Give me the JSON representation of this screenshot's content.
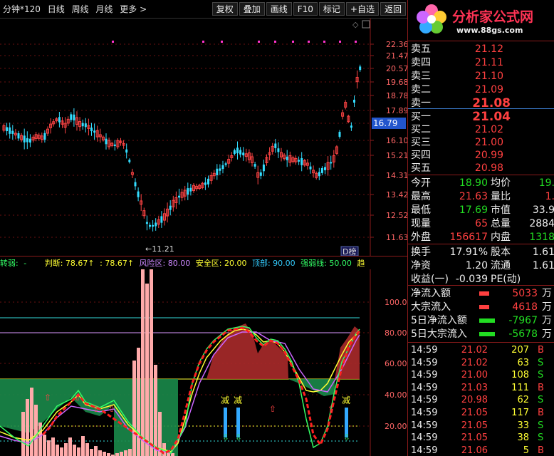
{
  "toolbar": {
    "left_items": [
      "分钟*120",
      "日线",
      "周线",
      "月线",
      "更多 >"
    ],
    "buttons": [
      "复权",
      "叠加",
      "画线",
      "F10",
      "标记",
      "+自选",
      "返回"
    ]
  },
  "price_chart": {
    "y_ticks": [
      "22.36",
      "21.47",
      "20.57",
      "19.68",
      "18.78",
      "17.89",
      "16.79",
      "16.10",
      "15.21",
      "14.31",
      "13.42",
      "12.52",
      "11.63"
    ],
    "current_price_label": "16.79",
    "low_annotation": "←11.21",
    "corner_badge": "D榜"
  },
  "indicator": {
    "header": [
      {
        "text": "转弱:",
        "color": "#33ff66"
      },
      {
        "text": "-",
        "color": "#33ff66"
      },
      {
        "text": "判断: 78.67↑",
        "color": "#ffff33"
      },
      {
        "text": ": 78.67↑",
        "color": "#ffff33"
      },
      {
        "text": "风险区: 80.00",
        "color": "#cc88ff"
      },
      {
        "text": "安全区: 20.00",
        "color": "#ffff33"
      },
      {
        "text": "顶部: 90.00",
        "color": "#33ccff"
      },
      {
        "text": "强弱线: 50.00",
        "color": "#33ff66"
      },
      {
        "text": "趋",
        "color": "#ffff33"
      }
    ],
    "y_ticks": [
      "100.0",
      "80.00",
      "60.00",
      "40.00",
      "20.00"
    ],
    "jian_label": "减"
  },
  "right_panel": {
    "logo": {
      "title": "分析家公式网",
      "url": "www.88gs.com"
    },
    "sell": [
      {
        "label": "卖五",
        "price": "21.12"
      },
      {
        "label": "卖四",
        "price": "21.11"
      },
      {
        "label": "卖三",
        "price": "21.10"
      },
      {
        "label": "卖二",
        "price": "21.09"
      },
      {
        "label": "卖一",
        "price": "21.08"
      }
    ],
    "buy": [
      {
        "label": "买一",
        "price": "21.04"
      },
      {
        "label": "买二",
        "price": "21.02"
      },
      {
        "label": "买三",
        "price": "21.00"
      },
      {
        "label": "买四",
        "price": "20.99"
      },
      {
        "label": "买五",
        "price": "20.98"
      }
    ],
    "stats": [
      {
        "l1": "今开",
        "v1": "18.90",
        "c1": "green",
        "l2": "均价",
        "v2": "19.",
        "c2": "green"
      },
      {
        "l1": "最高",
        "v1": "21.63",
        "c1": "red",
        "l2": "量比",
        "v2": "1.",
        "c2": "red"
      },
      {
        "l1": "最低",
        "v1": "17.69",
        "c1": "green",
        "l2": "市值",
        "v2": "33.9",
        "c2": "white"
      },
      {
        "l1": "现量",
        "v1": "65",
        "c1": "red",
        "l2": "总量",
        "v2": "2884",
        "c2": "white"
      },
      {
        "l1": "外盘",
        "v1": "156617",
        "c1": "red",
        "l2": "内盘",
        "v2": "1318",
        "c2": "green"
      }
    ],
    "stats2": [
      {
        "l1": "换手",
        "v1": "17.91%",
        "c1": "white",
        "l2": "股本",
        "v2": "1.61",
        "c2": "white"
      },
      {
        "l1": "净资",
        "v1": "1.20",
        "c1": "white",
        "l2": "流通",
        "v2": "1.61",
        "c2": "white"
      },
      {
        "l1": "收益(一)",
        "v1": "-0.039",
        "c1": "white",
        "l2": "PE(动)",
        "v2": "",
        "c2": "white"
      }
    ],
    "flows": [
      {
        "label": "净流入额",
        "value": "5033",
        "unit": "万",
        "color": "#ff4040",
        "bar_color": "#ff4040"
      },
      {
        "label": "大宗流入",
        "value": "4618",
        "unit": "万",
        "color": "#ff4040",
        "bar_color": "#ff4040"
      },
      {
        "label": "5日净流入额",
        "value": "-7967",
        "unit": "万",
        "color": "#22dd22",
        "bar_color": "#22dd22"
      },
      {
        "label": "5日大宗流入",
        "value": "-5678",
        "unit": "万",
        "color": "#22dd22",
        "bar_color": "#22dd22"
      }
    ],
    "ticks": [
      {
        "time": "14:59",
        "price": "21.02",
        "vol": "207",
        "bs": "B"
      },
      {
        "time": "14:59",
        "price": "21.02",
        "vol": "63",
        "bs": "S"
      },
      {
        "time": "14:59",
        "price": "21.00",
        "vol": "108",
        "bs": "S"
      },
      {
        "time": "14:59",
        "price": "21.03",
        "vol": "111",
        "bs": "B"
      },
      {
        "time": "14:59",
        "price": "20.98",
        "vol": "62",
        "bs": "S"
      },
      {
        "time": "14:59",
        "price": "21.05",
        "vol": "117",
        "bs": "B"
      },
      {
        "time": "14:59",
        "price": "21.05",
        "vol": "33",
        "bs": "S"
      },
      {
        "time": "14:59",
        "price": "21.05",
        "vol": "38",
        "bs": "S"
      },
      {
        "time": "14:59",
        "price": "21.06",
        "vol": "5",
        "bs": "B"
      }
    ]
  }
}
